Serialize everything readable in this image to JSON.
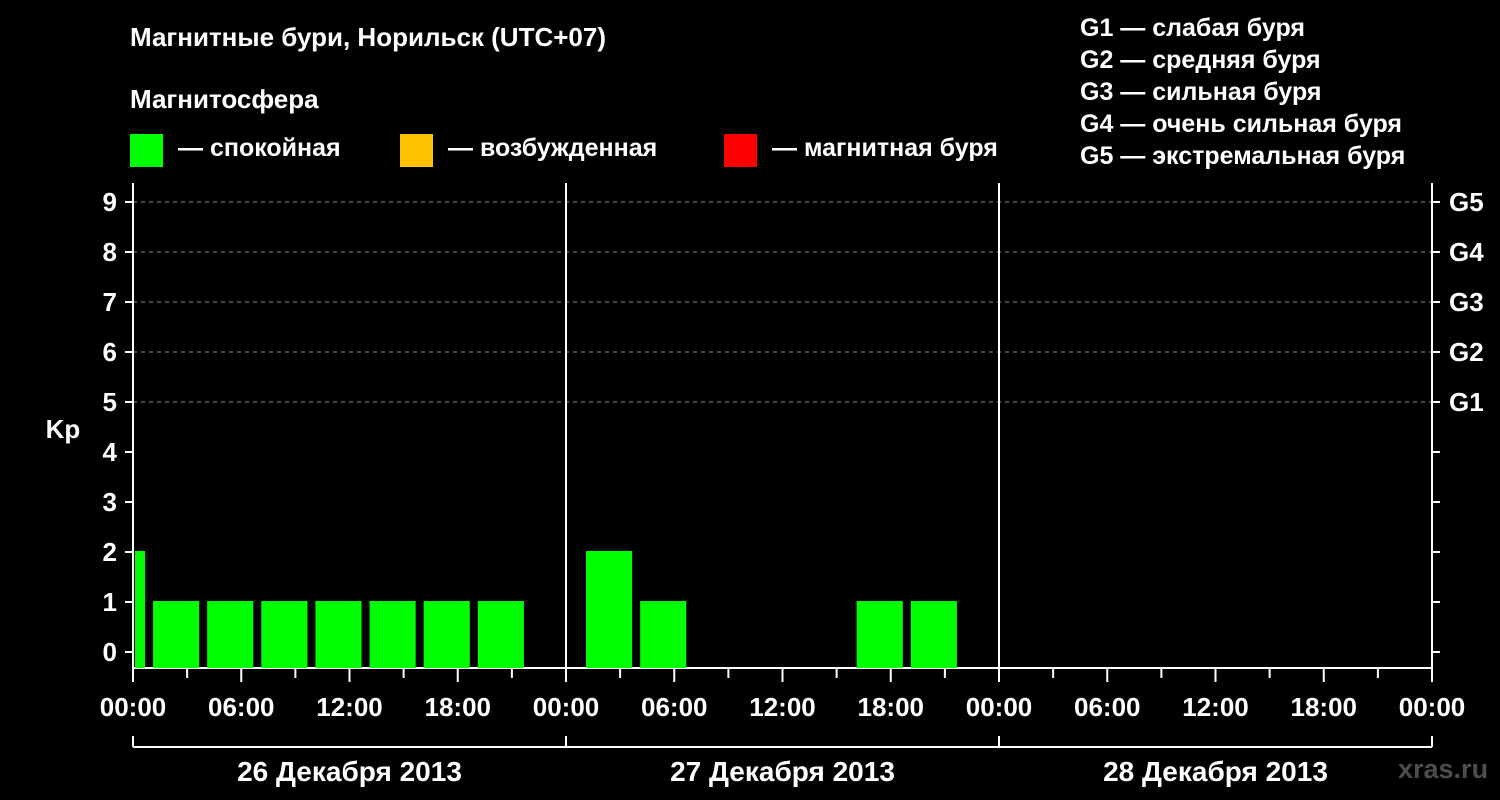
{
  "title": "Магнитные бури, Норильск (UTC+07)",
  "subtitle": "Магнитосфера",
  "legend": [
    {
      "label": "— спокойная",
      "color": "#00ff00"
    },
    {
      "label": "— возбужденная",
      "color": "#ffc000"
    },
    {
      "label": "— магнитная буря",
      "color": "#ff0000"
    }
  ],
  "g_legend": [
    "G1 — слабая буря",
    "G2 — средняя буря",
    "G3 — сильная буря",
    "G4 — очень сильная буря",
    "G5 — экстремальная буря"
  ],
  "watermark": "xras.ru",
  "chart_data": {
    "type": "bar",
    "ylabel": "Kp",
    "ylim": [
      0,
      9
    ],
    "yticks": [
      "0",
      "1",
      "2",
      "3",
      "4",
      "5",
      "6",
      "7",
      "8",
      "9"
    ],
    "g_levels": [
      {
        "kp": 5,
        "label": "G1"
      },
      {
        "kp": 6,
        "label": "G2"
      },
      {
        "kp": 7,
        "label": "G3"
      },
      {
        "kp": 8,
        "label": "G4"
      },
      {
        "kp": 9,
        "label": "G5"
      }
    ],
    "x_tick_labels": [
      "00:00",
      "06:00",
      "12:00",
      "18:00",
      "00:00",
      "06:00",
      "12:00",
      "18:00",
      "00:00",
      "06:00",
      "12:00",
      "18:00",
      "00:00"
    ],
    "days": [
      "26 Декабря 2013",
      "27 Декабря 2013",
      "28 Декабря 2013"
    ],
    "bar_color": "#00ff00",
    "series": [
      {
        "values": [
          {
            "start": "26 Декабря 2013 00:00",
            "end": "26 Декабря 2013 01:00",
            "kp": 2
          },
          {
            "start": "26 Декабря 2013 01:00",
            "end": "26 Декабря 2013 04:00",
            "kp": 1
          },
          {
            "start": "26 Декабря 2013 04:00",
            "end": "26 Декабря 2013 07:00",
            "kp": 1
          },
          {
            "start": "26 Декабря 2013 07:00",
            "end": "26 Декабря 2013 10:00",
            "kp": 1
          },
          {
            "start": "26 Декабря 2013 10:00",
            "end": "26 Декабря 2013 13:00",
            "kp": 1
          },
          {
            "start": "26 Декабря 2013 13:00",
            "end": "26 Декабря 2013 16:00",
            "kp": 1
          },
          {
            "start": "26 Декабря 2013 16:00",
            "end": "26 Декабря 2013 19:00",
            "kp": 1
          },
          {
            "start": "26 Декабря 2013 19:00",
            "end": "26 Декабря 2013 22:00",
            "kp": 1
          },
          {
            "start": "27 Декабря 2013 01:00",
            "end": "27 Декабря 2013 04:00",
            "kp": 2
          },
          {
            "start": "27 Декабря 2013 04:00",
            "end": "27 Декабря 2013 07:00",
            "kp": 1
          },
          {
            "start": "27 Декабря 2013 16:00",
            "end": "27 Декабря 2013 19:00",
            "kp": 1
          },
          {
            "start": "27 Декабря 2013 19:00",
            "end": "27 Декабря 2013 22:00",
            "kp": 1
          }
        ]
      }
    ]
  }
}
